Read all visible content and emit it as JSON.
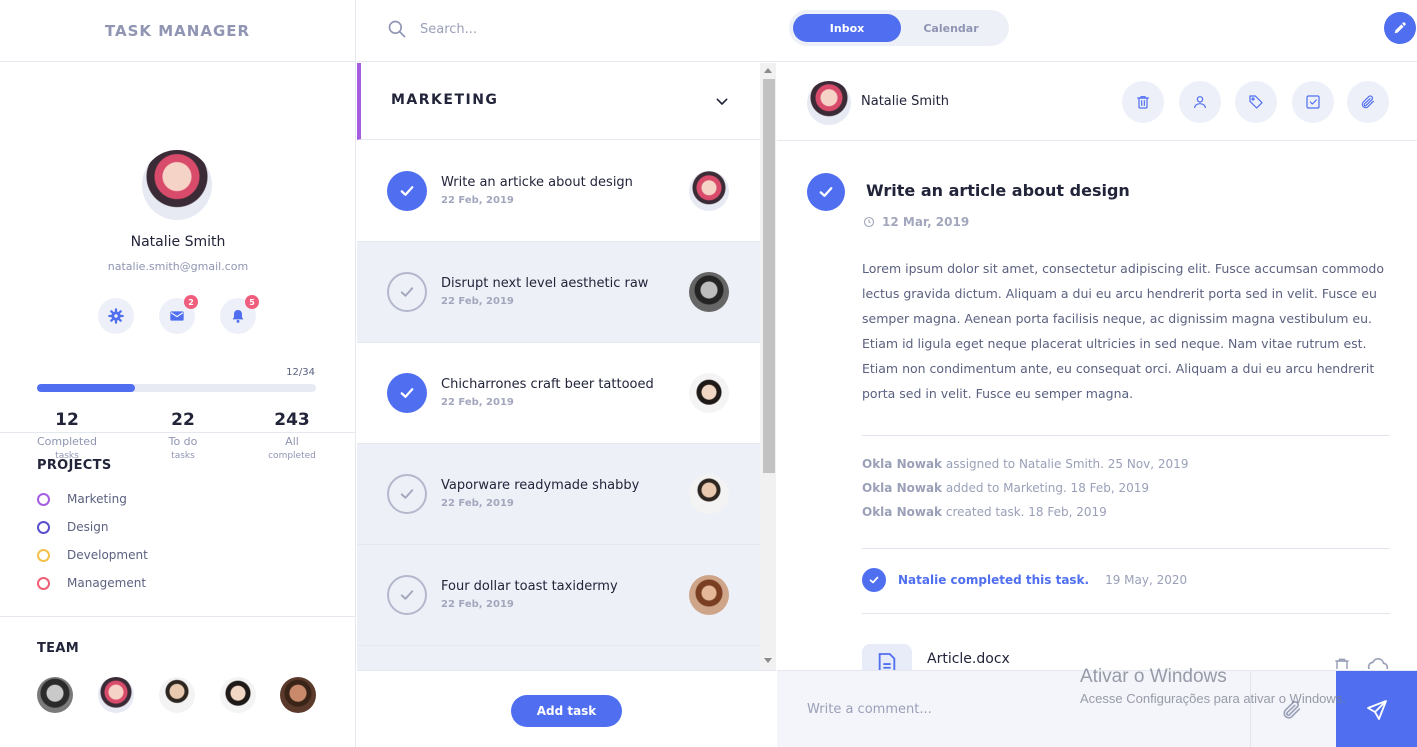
{
  "app": {
    "title": "TASK MANAGER"
  },
  "profile": {
    "name": "Natalie Smith",
    "email": "natalie.smith@gmail.com",
    "mail_badge": "2",
    "notification_badge": "5",
    "progress_text": "12/34",
    "progress_fraction": 0.35,
    "stats": [
      {
        "value": "12",
        "label": "Completed",
        "sub": "tasks"
      },
      {
        "value": "22",
        "label": "To do",
        "sub": "tasks"
      },
      {
        "value": "243",
        "label": "All",
        "sub": "completed"
      }
    ]
  },
  "projects": {
    "title": "PROJECTS",
    "items": [
      {
        "label": "Marketing",
        "color": "#a45de0"
      },
      {
        "label": "Design",
        "color": "#5a4fcf"
      },
      {
        "label": "Development",
        "color": "#f3c14b"
      },
      {
        "label": "Management",
        "color": "#ef5e74"
      }
    ]
  },
  "team": {
    "title": "TEAM"
  },
  "topbar": {
    "search_placeholder": "Search...",
    "view_tabs": {
      "inbox": "Inbox",
      "calendar": "Calendar"
    }
  },
  "tasklist": {
    "project_title": "MARKETING",
    "tasks": [
      {
        "title": "Write an articke about design",
        "date": "22 Feb, 2019",
        "done": true
      },
      {
        "title": "Disrupt next level aesthetic raw",
        "date": "22 Feb, 2019",
        "done": false
      },
      {
        "title": "Chicharrones craft beer tattooed",
        "date": "22 Feb, 2019",
        "done": true
      },
      {
        "title": "Vaporware readymade shabby",
        "date": "22 Feb, 2019",
        "done": false
      },
      {
        "title": "Four dollar toast taxidermy",
        "date": "22 Feb, 2019",
        "done": false
      }
    ],
    "add_button": "Add task"
  },
  "detail": {
    "owner": "Natalie Smith",
    "title": "Write an article about design",
    "date": "12 Mar, 2019",
    "body": "Lorem ipsum dolor sit amet, consectetur adipiscing elit. Fusce accumsan commodo lectus gravida dictum. Aliquam a dui eu arcu hendrerit porta sed in velit. Fusce eu semper magna. Aenean porta facilisis neque, ac dignissim magna vestibulum eu. Etiam id ligula eget neque placerat ultricies in sed neque. Nam vitae rutrum est. Etiam non condimentum ante, eu consequat orci. Aliquam a dui eu arcu hendrerit porta sed in velit. Fusce eu semper magna.",
    "activity": [
      {
        "who": "Okla Nowak",
        "what": "assigned to Natalie Smith. 25 Nov, 2019"
      },
      {
        "who": "Okla Nowak",
        "what": "added to Marketing. 18 Feb, 2019"
      },
      {
        "who": "Okla Nowak",
        "what": "created task. 18 Feb, 2019"
      }
    ],
    "completed_text": "Natalie completed this task.",
    "completed_date": "19 May, 2020",
    "file_name": "Article.docx",
    "comment_placeholder": "Write a comment..."
  },
  "watermark": {
    "title": "Ativar o Windows",
    "subtitle": "Acesse Configurações para ativar o Windows."
  },
  "colors": {
    "accent": "#4f6ff0",
    "badge": "#f05e7d"
  }
}
